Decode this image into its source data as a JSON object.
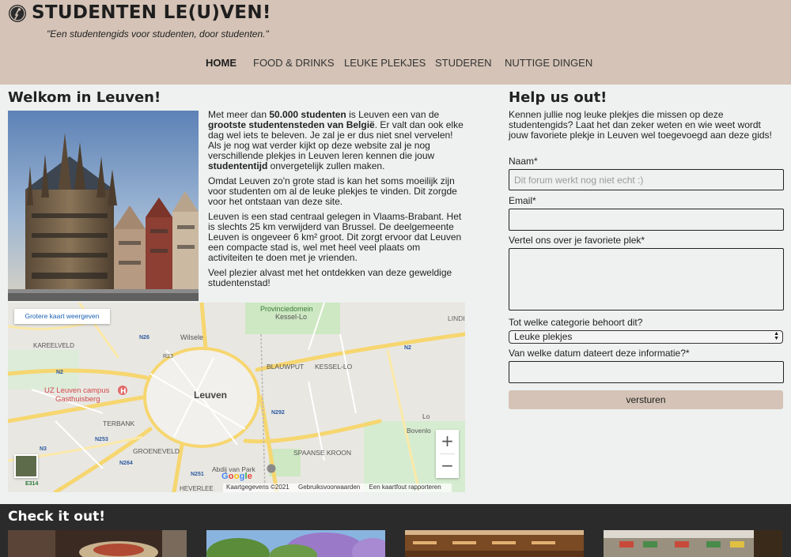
{
  "header": {
    "logo_icon": "pin-icon",
    "title": "STUDENTEN LE(U)VEN!",
    "tagline": "\"Een studentengids voor studenten, door studenten.\""
  },
  "nav": {
    "items": [
      {
        "label": "HOME",
        "active": true
      },
      {
        "label": "FOOD & DRINKS",
        "active": false
      },
      {
        "label": "LEUKE PLEKJES",
        "active": false
      },
      {
        "label": "STUDEREN",
        "active": false
      },
      {
        "label": "NUTTIGE DINGEN",
        "active": false
      }
    ]
  },
  "main": {
    "heading": "Welkom in Leuven!",
    "paragraphs": {
      "p1_a": "Met meer dan ",
      "p1_b": "50.000 studenten",
      "p1_c": " is Leuven een van de ",
      "p1_d": "grootste studentensteden van België",
      "p1_e": ". Er valt dan ook elke dag wel iets te beleven. Je zal je er dus niet snel vervelen! Als je nog wat verder kijkt op deze website zal je nog verschillende plekjes in Leuven leren kennen die jouw ",
      "p1_f": "studententijd",
      "p1_g": " onvergetelijk zullen maken.",
      "p2": "Omdat Leuven zo'n grote stad is kan het soms moeilijk zijn voor studenten om al de leuke plekjes te vinden. Dit zorgde voor het ontstaan van deze site.",
      "p3": "Leuven is een stad centraal gelegen in Vlaams-Brabant. Het is slechts 25 km verwijderd van Brussel. De deelgemeente Leuven is ongeveer 6 km² groot. Dit zorgt ervoor dat Leuven een compacte stad is, wel met heel veel plaats om activiteiten te doen met je vrienden.",
      "p4": "Veel plezier alvast met het ontdekken van deze geweldige studentenstad!"
    }
  },
  "map": {
    "larger_map_button": "Grotere kaart weergeven",
    "zoom_in": "+",
    "zoom_out": "−",
    "google": "Google",
    "footer": [
      "Kaartgegevens ©2021",
      "Gebruiksvoorwaarden",
      "Een kaartfout rapporteren"
    ],
    "labels": {
      "provinciedomein": "Provinciedomein",
      "kessel_lo_top": "Kessel-Lo",
      "linden": "LINDI",
      "n26": "N26",
      "kareelveld": "KAREELVELD",
      "wilsele": "Wilsele",
      "r23": "R23",
      "blauwput": "BLAUWPUT",
      "kessel_lo": "KESSEL-LO",
      "n2": "N2",
      "uz": "UZ Leuven campus",
      "gasthuisberg": "Gasthuisberg",
      "leuven": "Leuven",
      "n292": "N292",
      "terbank": "TERBANK",
      "n253": "N253",
      "groeneveld": "GROENEVELD",
      "spaanse_kroon": "SPAANSE KROON",
      "n264": "N264",
      "n3": "N3",
      "bovenlo": "Bovenlo",
      "lo": "Lo",
      "abdij": "Abdij van Park",
      "heverlee": "HEVERLEE",
      "n251": "N251",
      "e314": "E314"
    }
  },
  "form": {
    "heading": "Help us out!",
    "intro": "Kennen jullie nog leuke plekjes die missen op deze studentengids? Laat het dan zeker weten en wie weet wordt jouw favoriete plekje in Leuven wel toegevoegd aan deze gids!",
    "name_label": "Naam*",
    "name_placeholder": "Dit forum werkt nog niet echt :)",
    "email_label": "Email*",
    "place_label": "Vertel ons over je favoriete plek*",
    "category_label": "Tot welke categorie behoort dit?",
    "category_value": "Leuke plekjes",
    "date_label": "Van welke datum dateert deze informatie?*",
    "submit_label": "versturen"
  },
  "check": {
    "heading": "Check it out!"
  },
  "colors": {
    "header_bg": "#d4c3b6",
    "page_bg": "#eef1ef",
    "footer_bg": "#2b2b2b"
  }
}
